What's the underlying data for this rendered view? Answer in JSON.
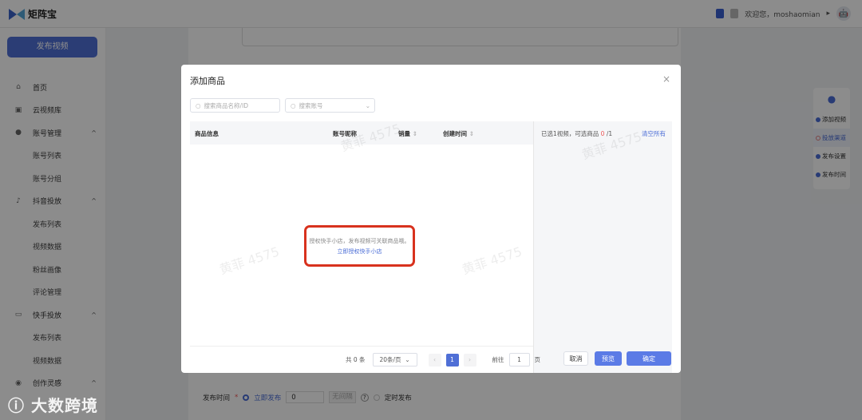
{
  "header": {
    "app_name": "矩阵宝",
    "welcome": "欢迎您，moshaomian",
    "caret": "▸",
    "avatar": "🤖"
  },
  "sidebar": {
    "publish_button": "发布视频",
    "items": [
      {
        "label": "首页",
        "icon": "home-icon",
        "glyph": "⌂"
      },
      {
        "label": "云视频库",
        "icon": "video-library-icon",
        "glyph": "▣"
      },
      {
        "label": "账号管理",
        "icon": "user-icon",
        "glyph": "●",
        "expanded": true
      },
      {
        "label": "账号列表",
        "sub": true
      },
      {
        "label": "账号分组",
        "sub": true
      },
      {
        "label": "抖音投放",
        "icon": "tiktok-icon",
        "glyph": "♪",
        "expanded": true
      },
      {
        "label": "发布列表",
        "sub": true
      },
      {
        "label": "视频数据",
        "sub": true
      },
      {
        "label": "粉丝画像",
        "sub": true
      },
      {
        "label": "评论管理",
        "sub": true
      },
      {
        "label": "快手投放",
        "icon": "kuaishou-icon",
        "glyph": "▭",
        "expanded": true
      },
      {
        "label": "发布列表",
        "sub": true
      },
      {
        "label": "视频数据",
        "sub": true
      },
      {
        "label": "创作灵感",
        "icon": "bulb-icon",
        "glyph": "◉",
        "expanded": true
      }
    ],
    "chevron": "^"
  },
  "steps": [
    {
      "label": "添加视频",
      "status": "done"
    },
    {
      "label": "投放渠道",
      "status": "warning"
    },
    {
      "label": "发布设置",
      "status": "done"
    },
    {
      "label": "发布时间",
      "status": "done"
    }
  ],
  "publish_time": {
    "label": "发布时间",
    "required": "*",
    "option_now": "立即发布",
    "interval_value": "0",
    "interval_unit": "无间隔",
    "help": "?",
    "option_scheduled": "定时发布"
  },
  "modal": {
    "title": "添加商品",
    "close": "×",
    "search_product_placeholder": "搜索商品名称/ID",
    "search_account_placeholder": "搜索账号",
    "columns": [
      "商品信息",
      "账号昵称",
      "销量",
      "创建时间"
    ],
    "sort_icon": "⇕",
    "empty_text": "授权快手小店，发布视频可关联商品哦。",
    "empty_link": "立即授权快手小店",
    "selected_info_prefix": "已选1视频，可选商品",
    "selected_count": "0",
    "selected_max": "/1",
    "clear_all": "清空所有",
    "pagination": {
      "total": "共 0 条",
      "page_size": "20条/页",
      "prev": "‹",
      "current": "1",
      "next": "›",
      "goto_label": "前往",
      "goto_value": "1",
      "page_suffix": "页"
    },
    "cancel": "取消",
    "preview": "预览",
    "confirm": "确定"
  },
  "watermark": "黄菲 4575",
  "brand_watermark": "大数跨境",
  "colors": {
    "primary": "#4f6fd6",
    "highlight": "#d8321e"
  }
}
